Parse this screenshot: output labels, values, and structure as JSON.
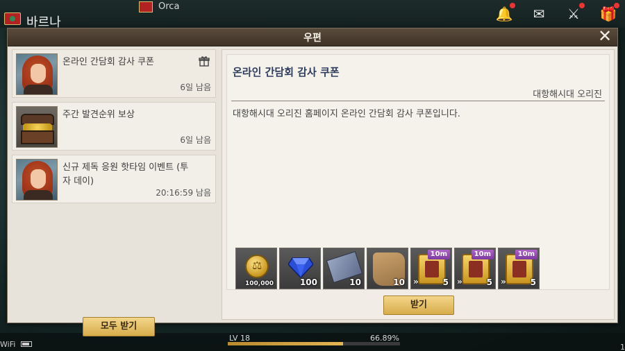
{
  "hud": {
    "player_name": "바르나",
    "guild_name": "Orca",
    "level_label": "LV 18",
    "xp_percent_label": "66.89%",
    "xp_fraction": 0.6689,
    "wifi_label": "WiFi",
    "right_edge_digit": "1"
  },
  "dialog": {
    "title": "우편",
    "close_glyph": "✕"
  },
  "mail_list": {
    "items": [
      {
        "title": "온라인 간담회 감사 쿠폰",
        "remaining": "6일 남음",
        "thumb": "portrait",
        "has_gift_icon": true
      },
      {
        "title": "주간 발견순위 보상",
        "remaining": "6일 남음",
        "thumb": "treasure-chest",
        "has_gift_icon": false
      },
      {
        "title": "신규 제독 응원 핫타임 이벤트 (투자 데이)",
        "remaining": "20:16:59 남음",
        "thumb": "portrait",
        "has_gift_icon": false
      }
    ],
    "receive_all_label": "모두 받기"
  },
  "detail": {
    "title": "온라인 간담회 감사 쿠폰",
    "sender": "대항해시대 오리진",
    "body": "대항해시대 오리진 홈페이지 온라인 간담회 감사 쿠폰입니다.",
    "attachments": [
      {
        "icon": "gold-coin-icon",
        "count": "100,000"
      },
      {
        "icon": "blue-gem-icon",
        "count": "100"
      },
      {
        "icon": "blueprint-scroll-icon",
        "count": "10"
      },
      {
        "icon": "treasure-map-icon",
        "count": "10"
      },
      {
        "icon": "boost-ticket-icon",
        "count": "5",
        "time": "10m"
      },
      {
        "icon": "boost-ticket-icon",
        "count": "5",
        "time": "10m"
      },
      {
        "icon": "boost-ticket-icon",
        "count": "5",
        "time": "10m"
      }
    ],
    "receive_label": "받기"
  }
}
